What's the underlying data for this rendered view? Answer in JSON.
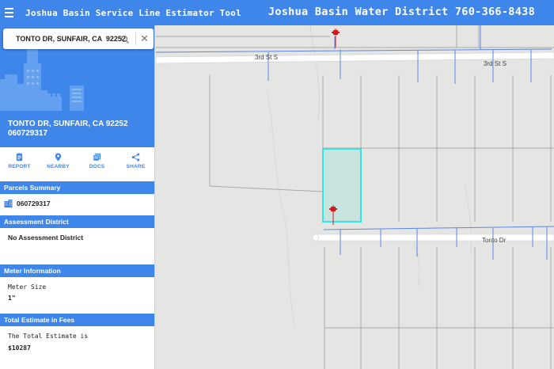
{
  "header": {
    "app_title": "Joshua Basin Service Line Estimator Tool",
    "district_title": "Joshua Basin Water District 760-366-8438",
    "menu_icon": "hamburger-menu-icon"
  },
  "search": {
    "value": "TONTO DR, SUNFAIR, CA  92252",
    "search_icon": "search-icon",
    "close_icon": "close-icon"
  },
  "address": {
    "line1": "TONTO DR, SUNFAIR, CA  92252",
    "parcel": "060729317"
  },
  "actions": [
    {
      "label": "REPORT",
      "icon": "report-icon"
    },
    {
      "label": "NEARBY",
      "icon": "location-pin-icon"
    },
    {
      "label": "DOCS",
      "icon": "docs-icon"
    },
    {
      "label": "SHARE",
      "icon": "share-icon"
    }
  ],
  "sections": {
    "parcels": {
      "title": "Parcels Summary",
      "value": "060729317",
      "icon": "building-icon"
    },
    "assessment": {
      "title": "Assessment District",
      "value": "No Assessment District"
    },
    "meter": {
      "title": "Meter Information",
      "label": "Meter Size",
      "value": "1\""
    },
    "estimate": {
      "title": "Total Estimate in Fees",
      "label": "The Total Estimate is",
      "value": "$10287"
    }
  },
  "map": {
    "street_top": "3rd St S",
    "street_bottom": "Tonto Dr",
    "marker_icon": "fire-hydrant-marker-icon",
    "colors": {
      "background": "#e5e5e3",
      "road": "#ffffff",
      "parcel_line": "#a9a9a9",
      "water_line": "#5b86e5",
      "selected_parcel_stroke": "#33e6e6",
      "selected_parcel_fill": "#bfe3dc",
      "marker": "#d11a1a"
    }
  },
  "theme": {
    "primary": "#3f86ea"
  }
}
